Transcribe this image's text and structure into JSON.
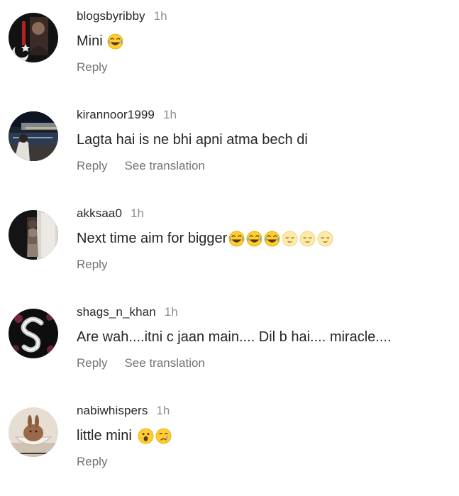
{
  "comments": [
    {
      "username": "blogsbyribby",
      "time": "1h",
      "text": "Mini",
      "emojis": [
        "joy-emoji"
      ],
      "reply_label": "Reply",
      "translate_label": ""
    },
    {
      "username": "kirannoor1999",
      "time": "1h",
      "text": "Lagta hai is ne bhi apni atma bech di",
      "emojis": [],
      "reply_label": "Reply",
      "translate_label": "See translation"
    },
    {
      "username": "akksaa0",
      "time": "1h",
      "text": "Next time aim for bigger",
      "emojis": [
        "joy-emoji",
        "joy-emoji",
        "joy-emoji",
        "relieved-emoji",
        "relieved-emoji",
        "relieved-emoji"
      ],
      "reply_label": "Reply",
      "translate_label": ""
    },
    {
      "username": "shags_n_khan",
      "time": "1h",
      "text": "Are wah....itni c jaan main.... Dil b hai.... miracle....",
      "emojis": [],
      "reply_label": "Reply",
      "translate_label": "See translation"
    },
    {
      "username": "nabiwhispers",
      "time": "1h",
      "text": "little mini",
      "emojis": [
        "open-mouth-emoji",
        "crying-emoji"
      ],
      "reply_label": "Reply",
      "translate_label": ""
    }
  ]
}
